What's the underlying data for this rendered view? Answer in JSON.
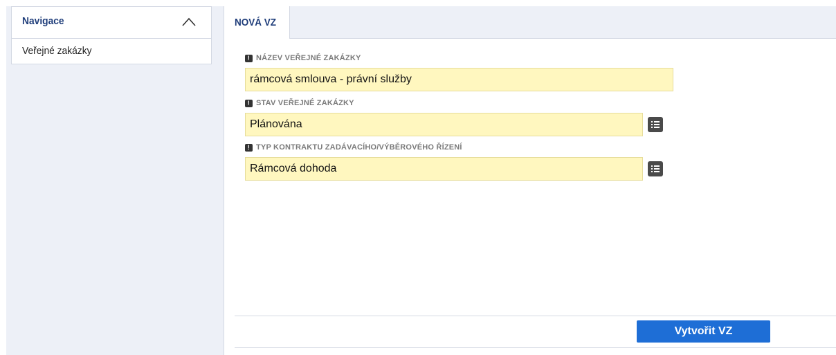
{
  "navigation": {
    "title": "Navigace",
    "items": [
      {
        "label": "Veřejné zakázky"
      }
    ]
  },
  "tabs": [
    {
      "label": "NOVÁ VZ",
      "active": true
    }
  ],
  "form": {
    "required_marker": "!",
    "fields": [
      {
        "label": "NÁZEV VEŘEJNÉ ZAKÁZKY",
        "value": "rámcová smlouva - právní služby",
        "has_list_button": false
      },
      {
        "label": "STAV VEŘEJNÉ ZAKÁZKY",
        "value": "Plánována",
        "has_list_button": true
      },
      {
        "label": "TYP KONTRAKTU ZADÁVACÍHO/VÝBĚROVÉHO ŘÍZENÍ",
        "value": "Rámcová dohoda",
        "has_list_button": true
      }
    ]
  },
  "actions": {
    "create_label": "Vytvořit VZ"
  },
  "icons": {
    "collapse": "chevron-up-icon",
    "list": "list-icon",
    "required": "required-icon"
  },
  "colors": {
    "nav_title": "#1f3d7a",
    "field_background": "#fff7bf",
    "primary_button": "#1e6ed6",
    "panel_background": "#edf0f7"
  }
}
